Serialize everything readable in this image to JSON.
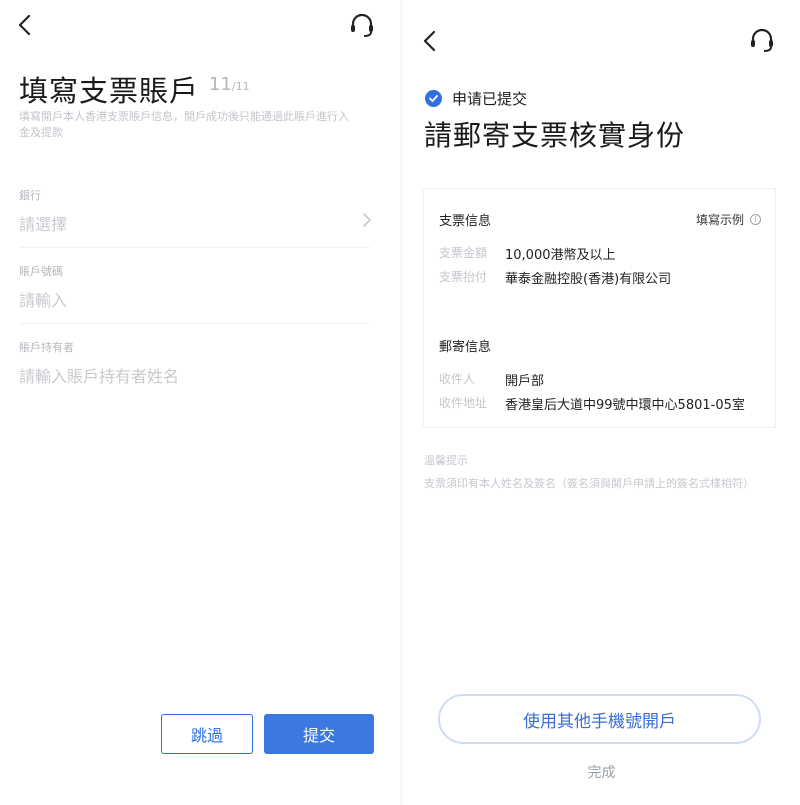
{
  "left": {
    "title": "填寫支票賬戶",
    "step_current": "11",
    "step_total": "/11",
    "description": "填寫開戶本人香港支票賬戶信息，開戶成功後只能通過此賬戶進行入金及提款",
    "fields": [
      {
        "label": "銀行",
        "placeholder": "請選擇"
      },
      {
        "label": "賬戶號碼",
        "placeholder": "請輸入"
      },
      {
        "label": "賬戶持有者",
        "placeholder": "請輸入賬戶持有者姓名"
      }
    ],
    "skip_label": "跳過",
    "submit_label": "提交"
  },
  "right": {
    "status": "申请已提交",
    "title": "請郵寄支票核實身份",
    "card": {
      "cheque_section": "支票信息",
      "example_link": "填寫示例",
      "amount_key": "支票金額",
      "amount_value": "10,000港幣及以上",
      "payee_key": "支票抬付",
      "payee_value": "華泰金融控股(香港)有限公司",
      "mail_section": "郵寄信息",
      "recipient_key": "收件人",
      "recipient_value": "開戶部",
      "address_key": "收件地址",
      "address_value": "香港皇后大道中99號中環中心5801-05室"
    },
    "tip_title": "溫馨提示",
    "tip": "支票須印有本人姓名及簽名（簽名須與開戶申請上的簽名式樣相符）",
    "other_phone_button": "使用其他手機號開戶",
    "done_label": "完成"
  },
  "icons": {
    "back": "back-arrow-icon",
    "support": "headset-icon",
    "chevron": "chevron-right-icon",
    "status": "check-circle-icon",
    "info": "info-icon"
  },
  "colors": {
    "accent": "#3b78e0",
    "text": "#1a1a1a",
    "muted": "#c2c5ca"
  }
}
